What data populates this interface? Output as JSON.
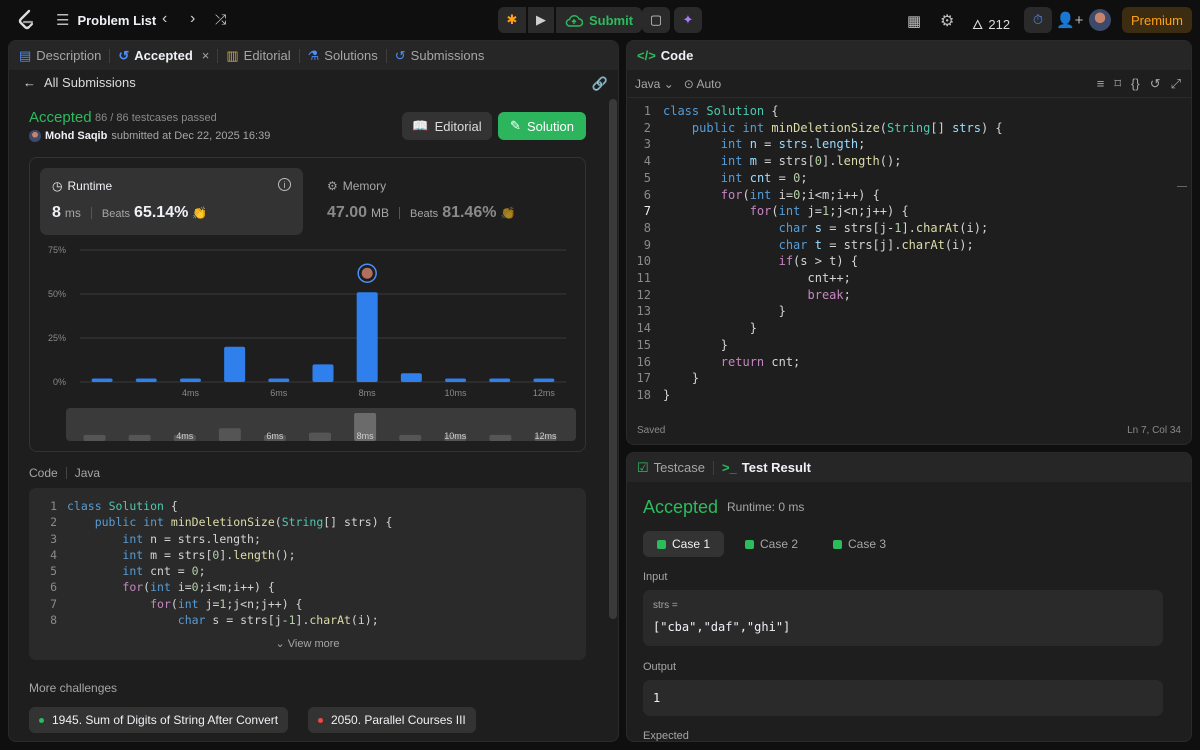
{
  "topbar": {
    "title": "Problem List",
    "submit_label": "Submit",
    "streak": "212",
    "premium": "Premium"
  },
  "left": {
    "tabs": [
      {
        "label": "Description"
      },
      {
        "label": "Accepted"
      },
      {
        "label": "Editorial"
      },
      {
        "label": "Solutions"
      },
      {
        "label": "Submissions"
      }
    ],
    "all_submissions": "All Submissions",
    "status": "Accepted",
    "testcases": "86 / 86 testcases passed",
    "user": "Mohd Saqib",
    "submitted_at": "submitted at Dec 22, 2025 16:39",
    "editorial_btn": "Editorial",
    "solution_btn": "Solution",
    "runtime": {
      "label": "Runtime",
      "value": "8",
      "unit": "ms",
      "beats_label": "Beats",
      "beats": "65.14%"
    },
    "memory": {
      "label": "Memory",
      "value": "47.00",
      "unit": "MB",
      "beats_label": "Beats",
      "beats": "81.46%"
    },
    "code_label": "Code",
    "code_lang": "Java",
    "view_more": "View more",
    "more_challenges": "More challenges",
    "challenges": [
      {
        "label": "1945. Sum of Digits of String After Convert",
        "color": "#2cbb5d"
      },
      {
        "label": "2050. Parallel Courses III",
        "color": "#ef4743"
      }
    ]
  },
  "chart_data": {
    "type": "bar",
    "categories": [
      "",
      "",
      "4ms",
      "",
      "6ms",
      "",
      "8ms",
      "",
      "10ms",
      "",
      "12ms"
    ],
    "values": [
      2,
      2,
      2,
      20,
      2,
      10,
      51,
      5,
      2,
      2,
      2
    ],
    "ylabels": [
      "75%",
      "50%",
      "25%",
      "0%"
    ],
    "ylim": [
      0,
      75
    ],
    "highlight_index": 6,
    "bar_color": "#2f80ed",
    "mini_values": [
      2,
      2,
      2,
      8,
      2,
      4,
      22,
      2,
      2,
      2,
      2
    ]
  },
  "editor": {
    "title": "Code",
    "lang": "Java",
    "auto": "Auto",
    "saved": "Saved",
    "cursor": "Ln 7, Col 34"
  },
  "result": {
    "tabs": [
      {
        "label": "Testcase"
      },
      {
        "label": "Test Result"
      }
    ],
    "status": "Accepted",
    "runtime": "Runtime: 0 ms",
    "cases": [
      {
        "label": "Case 1"
      },
      {
        "label": "Case 2"
      },
      {
        "label": "Case 3"
      }
    ],
    "input_label": "Input",
    "input_var": "strs =",
    "input_val": "[\"cba\",\"daf\",\"ghi\"]",
    "output_label": "Output",
    "output_val": "1",
    "expected_label": "Expected"
  }
}
